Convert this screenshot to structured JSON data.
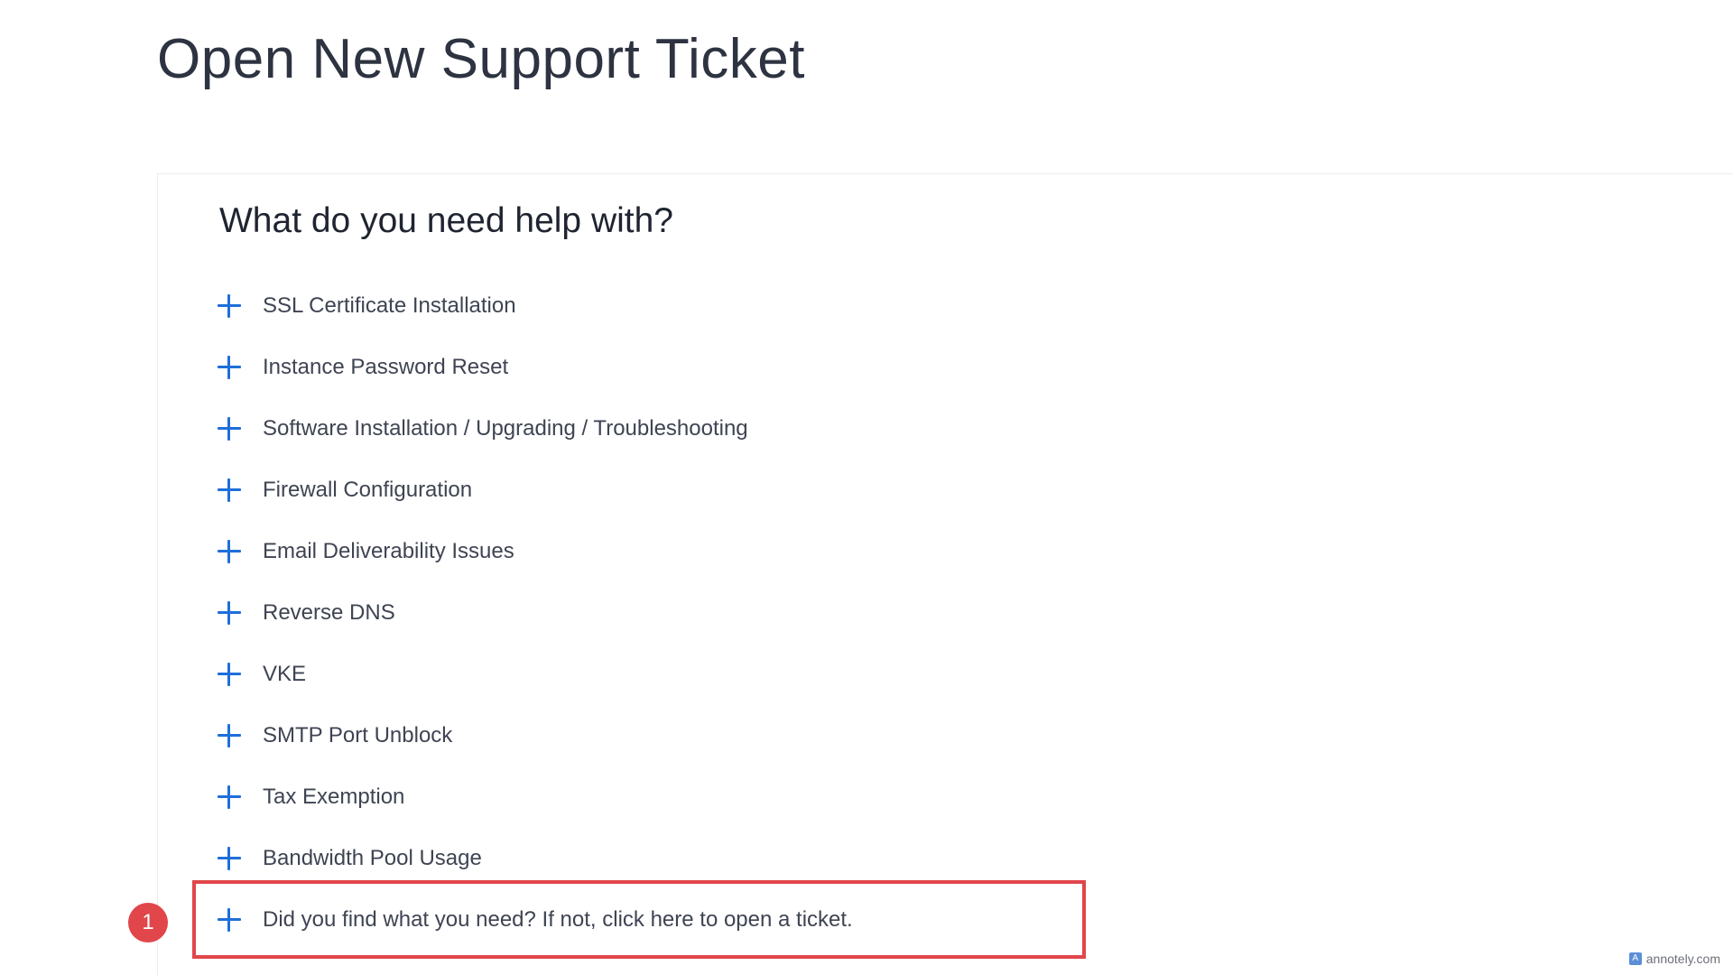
{
  "page": {
    "title": "Open New Support Ticket"
  },
  "help_panel": {
    "heading": "What do you need help with?",
    "topics": [
      {
        "label": "SSL Certificate Installation",
        "icon": "plus-icon"
      },
      {
        "label": "Instance Password Reset",
        "icon": "plus-icon"
      },
      {
        "label": "Software Installation / Upgrading / Troubleshooting",
        "icon": "plus-icon"
      },
      {
        "label": "Firewall Configuration",
        "icon": "plus-icon"
      },
      {
        "label": "Email Deliverability Issues",
        "icon": "plus-icon"
      },
      {
        "label": "Reverse DNS",
        "icon": "plus-icon"
      },
      {
        "label": "VKE",
        "icon": "plus-icon"
      },
      {
        "label": "SMTP Port Unblock",
        "icon": "plus-icon"
      },
      {
        "label": "Tax Exemption",
        "icon": "plus-icon"
      },
      {
        "label": "Bandwidth Pool Usage",
        "icon": "plus-icon"
      },
      {
        "label": "Did you find what you need? If not, click here to open a ticket.",
        "icon": "plus-icon"
      }
    ]
  },
  "annotation": {
    "step_number": "1",
    "highlight_color": "#e0464a"
  },
  "watermark": {
    "text": "annotely.com"
  },
  "colors": {
    "accent": "#1e6fd9",
    "text": "#3e4452",
    "title": "#2d3340"
  }
}
